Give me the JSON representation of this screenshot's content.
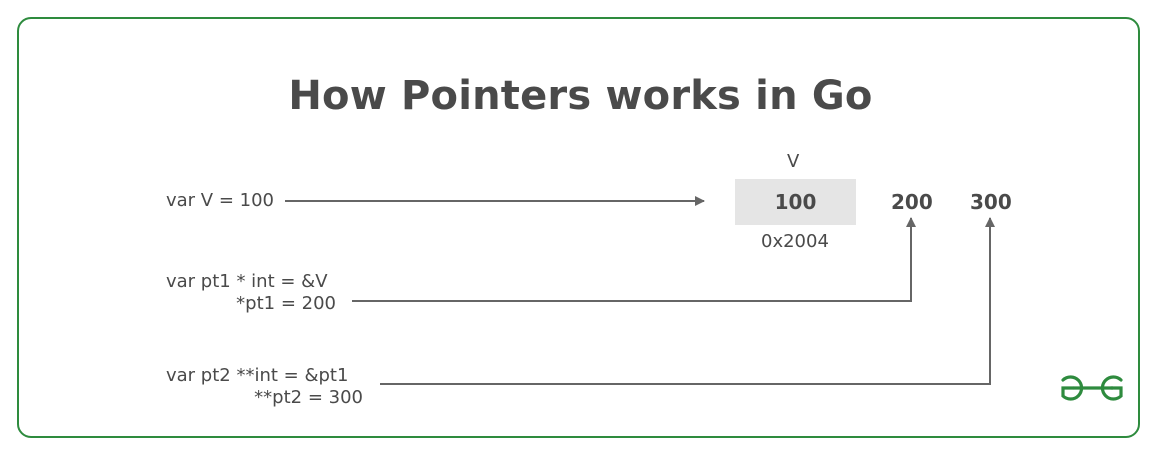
{
  "title": "How Pointers works in Go",
  "statements": {
    "declare_v": "var V = 100",
    "pt1_decl": "var pt1 * int = &V",
    "pt1_assign": "*pt1 = 200",
    "pt2_decl": "var pt2 **int = &pt1",
    "pt2_assign": "**pt2 = 300"
  },
  "memory": {
    "var_name": "V",
    "value": "100",
    "address": "0x2004",
    "updated_values": [
      "200",
      "300"
    ]
  },
  "colors": {
    "border": "#2e8b3e",
    "text": "#4a4a4a",
    "box": "#e5e5e5",
    "arrow": "#666666",
    "logo": "#2e8b3e"
  },
  "logo_icon": "gfg-logo-icon"
}
